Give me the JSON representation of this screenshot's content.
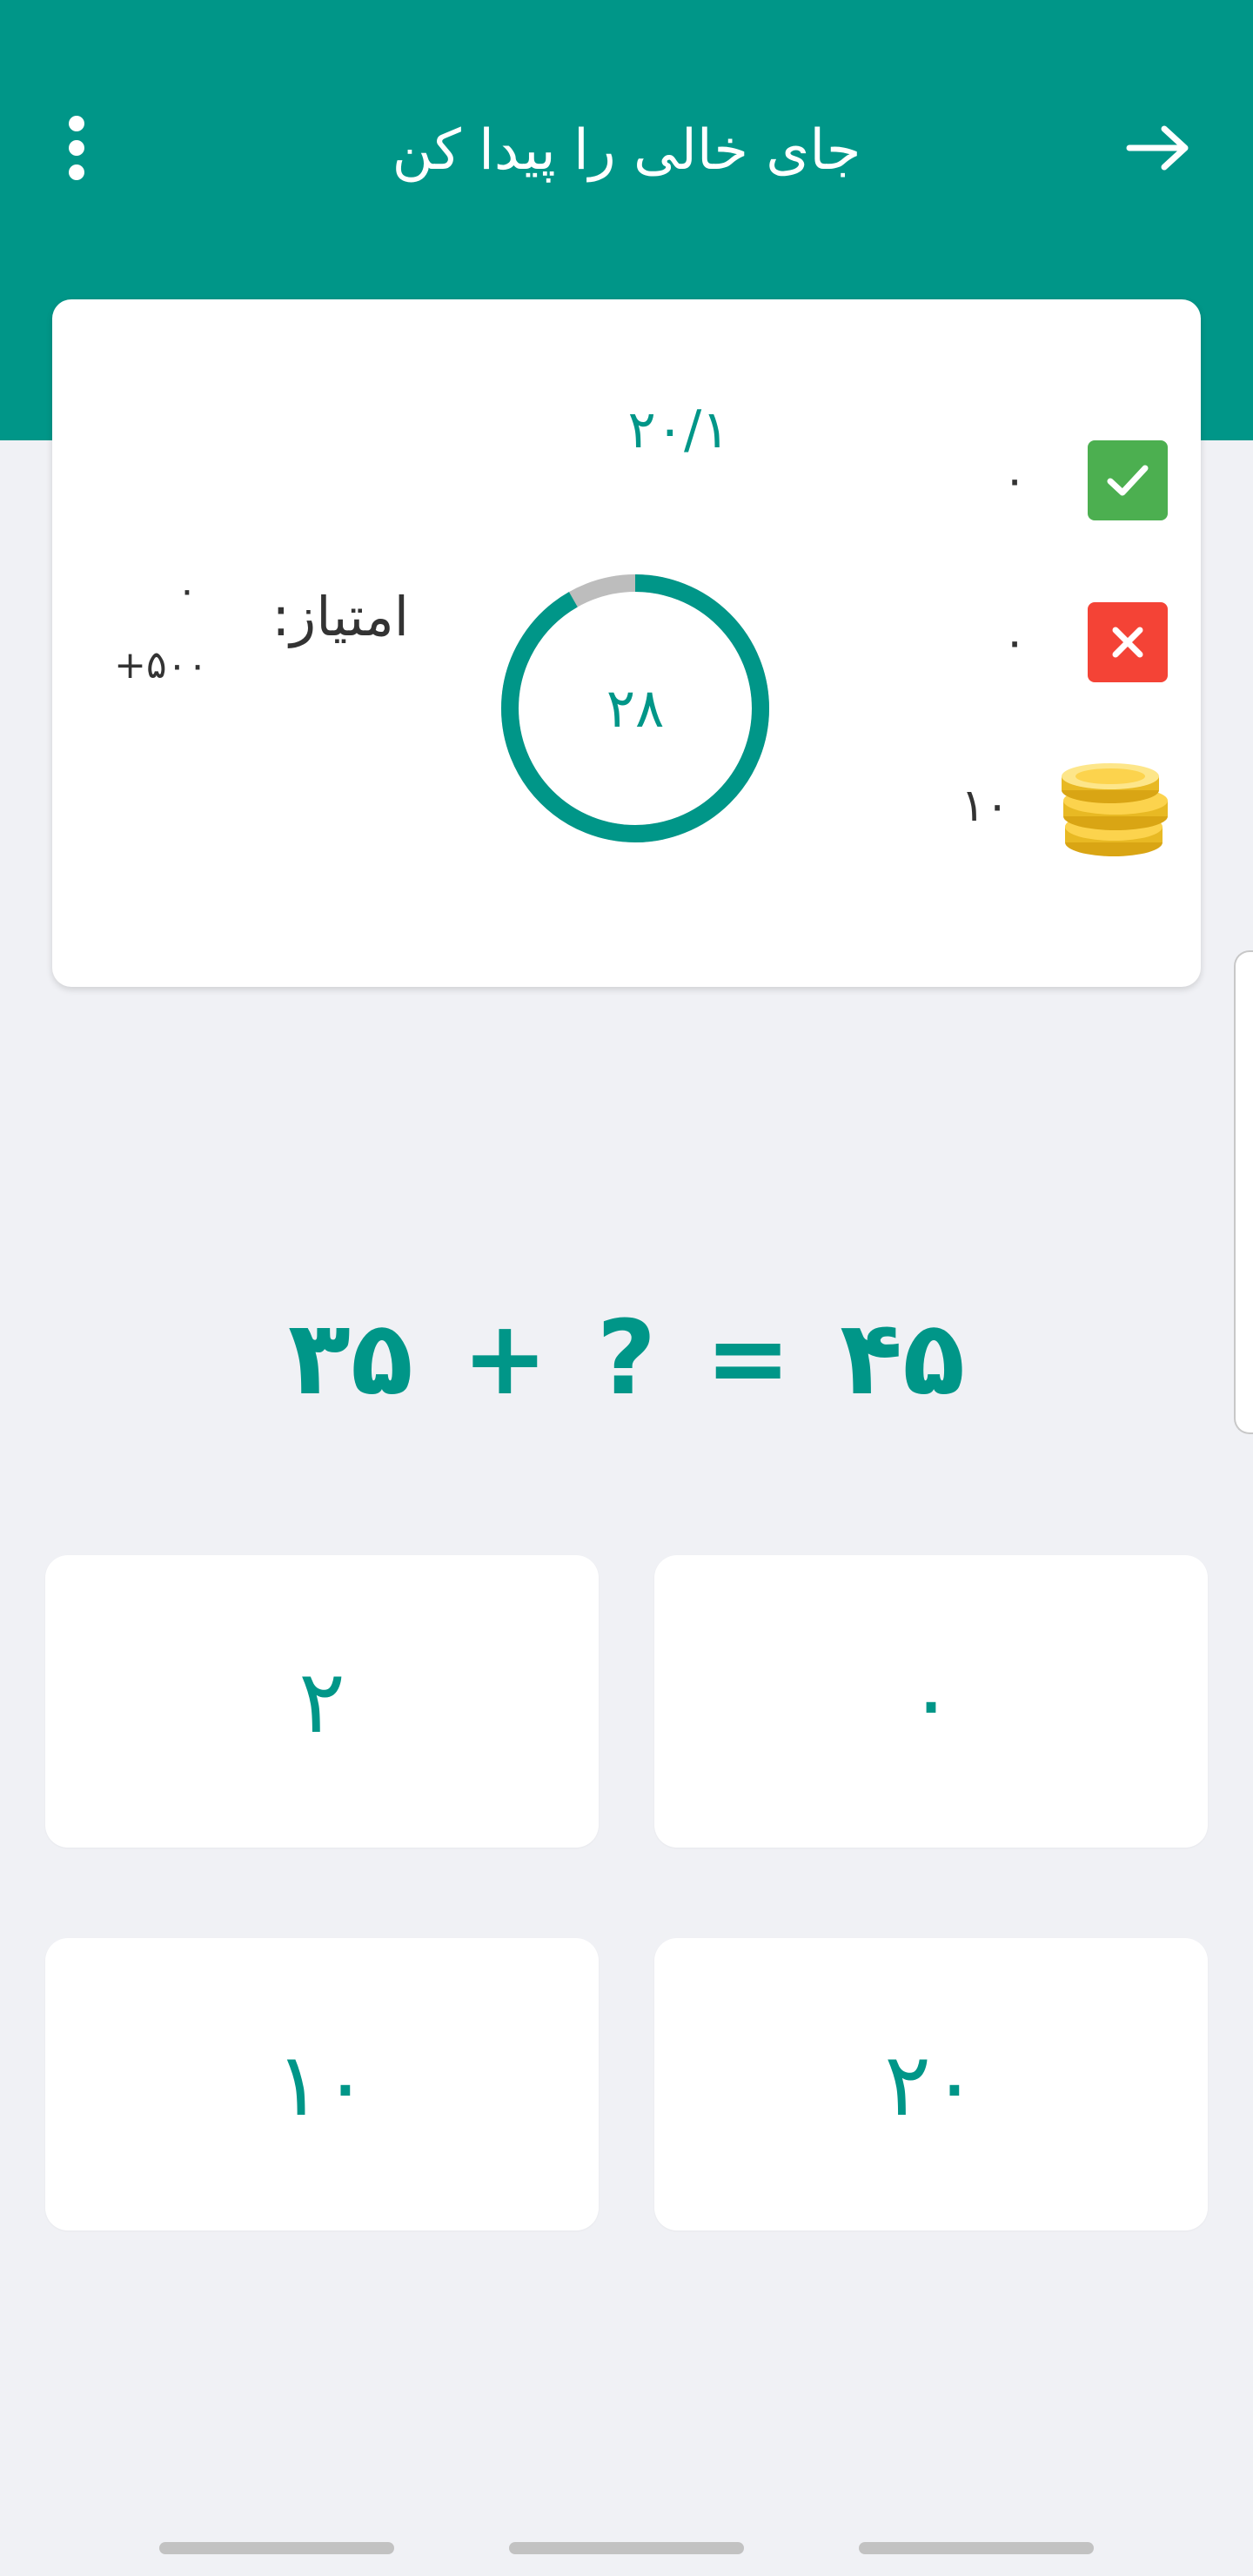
{
  "header": {
    "title": "جای خالی را پیدا کن",
    "back_icon": "arrow-back-icon",
    "menu_icon": "more-vert-icon",
    "color": "#009688"
  },
  "status_card": {
    "progress": "۲۰/۱",
    "timer": "۲۸",
    "correct_count": "۰",
    "wrong_count": "۰",
    "coins": "۱۰",
    "score_label": "امتیاز:",
    "score_value": "۰",
    "score_bonus": "+۵۰۰"
  },
  "question": {
    "left_operand": "۳۵",
    "operator": "+",
    "blank": "?",
    "equals": "=",
    "result": "۴۵"
  },
  "answers": [
    {
      "label": "۲"
    },
    {
      "label": "۰"
    },
    {
      "label": "۱۰"
    },
    {
      "label": "۲۰"
    }
  ],
  "colors": {
    "accent": "#009688",
    "correct": "#4caf50",
    "wrong": "#f44336",
    "background": "#f0f1f5"
  }
}
